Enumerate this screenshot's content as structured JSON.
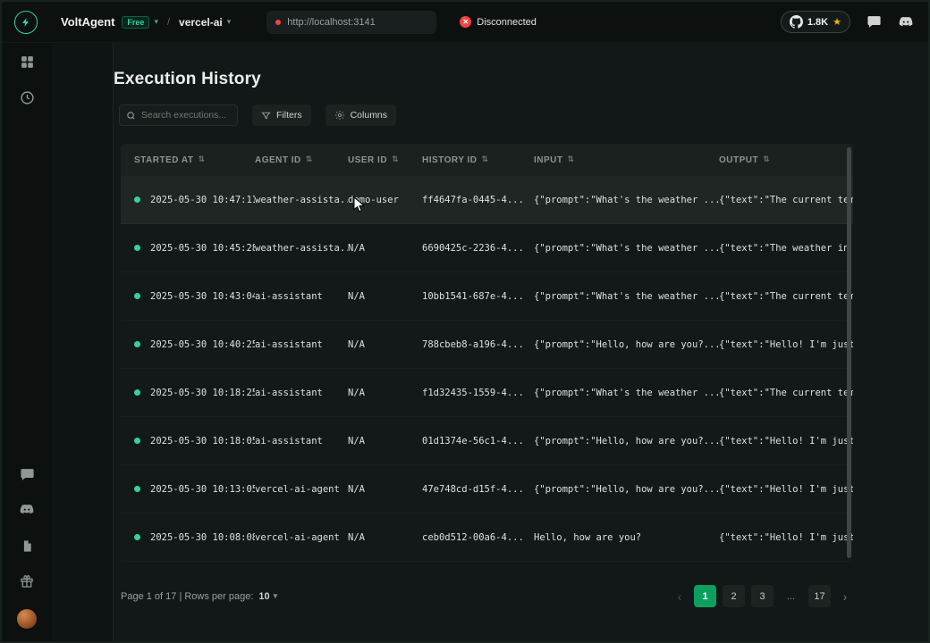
{
  "topbar": {
    "brand": "VoltAgent",
    "plan": "Free",
    "separator": "/",
    "project": "vercel-ai",
    "url": "http://localhost:3141",
    "status": "Disconnected",
    "github_stars": "1.8K"
  },
  "page": {
    "title": "Execution History"
  },
  "toolbar": {
    "search_placeholder": "Search executions...",
    "filters": "Filters",
    "columns": "Columns"
  },
  "table": {
    "headers": [
      "STARTED AT",
      "AGENT ID",
      "USER ID",
      "HISTORY ID",
      "INPUT",
      "OUTPUT"
    ],
    "rows": [
      [
        "2025-05-30 10:47:11",
        "weather-assista...",
        "demo-user",
        "ff4647fa-0445-4...",
        "{\"prompt\":\"What's the weather ...",
        "{\"text\":\"The current tempe"
      ],
      [
        "2025-05-30 10:45:28",
        "weather-assista...",
        "N/A",
        "6690425c-2236-4...",
        "{\"prompt\":\"What's the weather ...",
        "{\"text\":\"The weather in Pa"
      ],
      [
        "2025-05-30 10:43:04",
        "ai-assistant",
        "N/A",
        "10bb1541-687e-4...",
        "{\"prompt\":\"What's the weather ...",
        "{\"text\":\"The current tempe"
      ],
      [
        "2025-05-30 10:40:25",
        "ai-assistant",
        "N/A",
        "788cbeb8-a196-4...",
        "{\"prompt\":\"Hello, how are you?...",
        "{\"text\":\"Hello! I'm just a"
      ],
      [
        "2025-05-30 10:18:25",
        "ai-assistant",
        "N/A",
        "f1d32435-1559-4...",
        "{\"prompt\":\"What's the weather ...",
        "{\"text\":\"The current tempe"
      ],
      [
        "2025-05-30 10:18:05",
        "ai-assistant",
        "N/A",
        "01d1374e-56c1-4...",
        "{\"prompt\":\"Hello, how are you?...",
        "{\"text\":\"Hello! I'm just a"
      ],
      [
        "2025-05-30 10:13:05",
        "vercel-ai-agent",
        "N/A",
        "47e748cd-d15f-4...",
        "{\"prompt\":\"Hello, how are you?...",
        "{\"text\":\"Hello! I'm just a"
      ],
      [
        "2025-05-30 10:08:08",
        "vercel-ai-agent",
        "N/A",
        "ceb0d512-00a6-4...",
        "Hello, how are you?",
        "{\"text\":\"Hello! I'm just a"
      ]
    ]
  },
  "pagination": {
    "info": "Page 1 of 17 | Rows per page:",
    "rows_per_page": "10",
    "pages": [
      "1",
      "2",
      "3",
      "...",
      "17"
    ],
    "active": "1"
  },
  "glyphs": {
    "chevron_down": "▾",
    "sort": "⇅",
    "prev": "‹",
    "next": "›",
    "close_x": "✕",
    "star": "★"
  },
  "colors": {
    "accent": "#34d399",
    "active_page": "#0ca05e",
    "danger": "#ef4444",
    "star": "#eab308"
  }
}
